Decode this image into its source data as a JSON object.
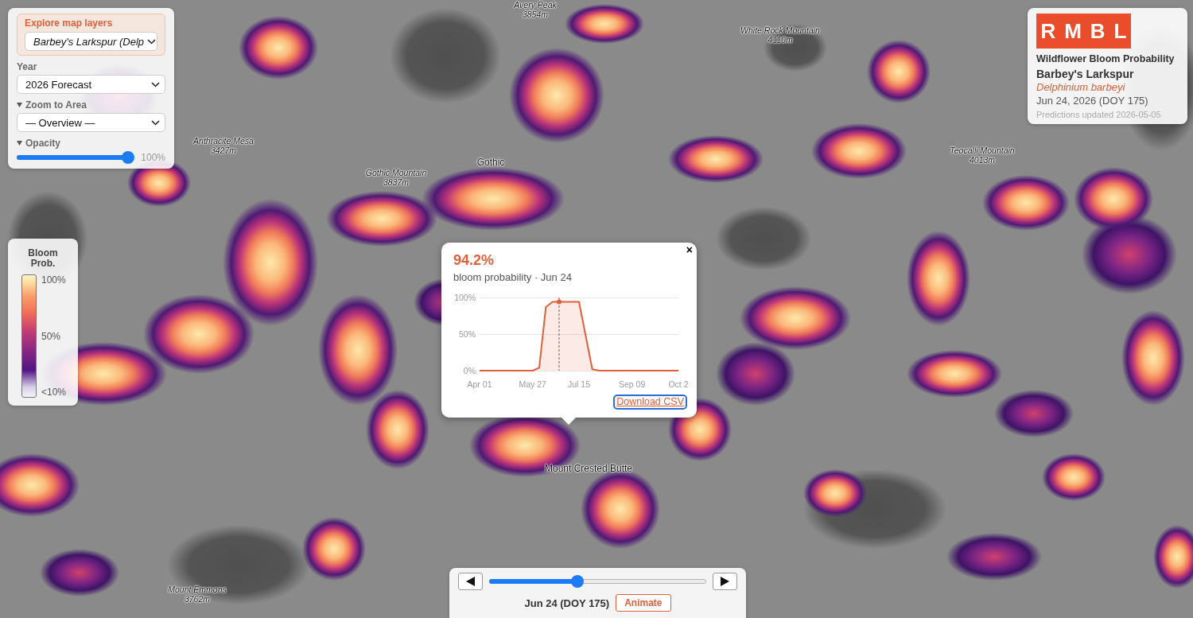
{
  "map": {
    "labels": [
      {
        "kind": "peak",
        "name": "Avery Peak",
        "elevation": "3854m"
      },
      {
        "kind": "peak",
        "name": "White Rock Mountain",
        "elevation": "4110m"
      },
      {
        "kind": "peak",
        "name": "Anthracite Mesa",
        "elevation": "3427m"
      },
      {
        "kind": "town",
        "name": "Gothic"
      },
      {
        "kind": "peak",
        "name": "Gothic Mountain",
        "elevation": "3837m"
      },
      {
        "kind": "peak",
        "name": "Teocalli Mountain",
        "elevation": "4013m"
      },
      {
        "kind": "town",
        "name": "Mount Crested Butte"
      },
      {
        "kind": "peak",
        "name": "Mount Emmons",
        "elevation": "3762m"
      }
    ]
  },
  "layer_panel": {
    "title": "Explore map layers",
    "layer_select": {
      "value": "Barbey's Larkspur (Delp"
    },
    "sections": [
      {
        "kind": "select",
        "label": "Year",
        "value": "2026 Forecast"
      },
      {
        "kind": "select",
        "label": "Zoom to Area",
        "expanded": true,
        "value": "— Overview —"
      },
      {
        "kind": "slider",
        "label": "Opacity",
        "expanded": true,
        "level": 1.0,
        "reading": "100%"
      }
    ]
  },
  "info_card": {
    "logo": "RMBL",
    "title": "Wildflower Bloom Probability",
    "common_name": "Barbey's Larkspur",
    "scientific_name": "Delphinium barbeyi",
    "date": "Jun 24, 2026 (DOY 175)",
    "updated": "Predictions updated 2026-05-05"
  },
  "legend": {
    "title": "Bloom Prob.",
    "labels": [
      "100%",
      "50%",
      "<10%"
    ]
  },
  "popup": {
    "close": "×",
    "value": "94.2%",
    "subtitle": "bloom probability · Jun 24",
    "chart_data": {
      "type": "area",
      "categories": [
        "Apr 01",
        null,
        null,
        null,
        null,
        null,
        null,
        null,
        "May 27",
        null,
        null,
        null,
        null,
        null,
        null,
        "Jul 15",
        null,
        null,
        null,
        null,
        null,
        null,
        null,
        "Sep 09",
        null,
        null,
        null,
        null,
        null,
        null,
        "Oct 2"
      ],
      "series": [
        {
          "color": "#e0603a",
          "values": [
            0,
            0,
            0,
            0,
            0,
            0,
            0,
            0,
            0,
            4,
            87,
            94,
            94,
            94,
            94,
            94,
            48,
            2,
            0,
            0,
            0,
            0,
            0,
            0,
            0,
            0,
            0,
            0,
            0,
            0,
            0
          ]
        }
      ],
      "ylim": [
        0,
        100
      ],
      "yticks": [
        {
          "value": 0,
          "label": "0%"
        },
        {
          "value": 50,
          "label": "50%"
        },
        {
          "value": 100,
          "label": "100%"
        }
      ]
    },
    "link": {
      "label": "Download CSV",
      "focused": true
    }
  },
  "timeline": {
    "level": 0.4,
    "date": "Jun 24 (DOY 175)",
    "button": "Animate"
  }
}
